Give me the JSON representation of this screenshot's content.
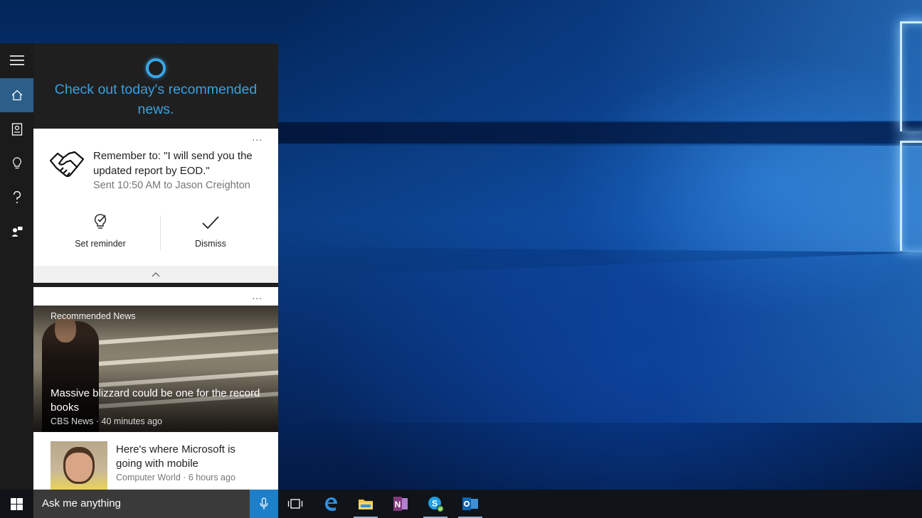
{
  "cortana": {
    "greeting": "Check out today's recommended news.",
    "rail": [
      {
        "name": "menu",
        "icon": "hamburger-menu-icon"
      },
      {
        "name": "home",
        "icon": "home-icon",
        "active": true
      },
      {
        "name": "notebook",
        "icon": "notebook-icon"
      },
      {
        "name": "reminders",
        "icon": "lightbulb-icon"
      },
      {
        "name": "help",
        "icon": "question-mark-icon"
      },
      {
        "name": "feedback",
        "icon": "feedback-icon"
      }
    ],
    "reminder_card": {
      "more": "...",
      "icon": "handshake-icon",
      "text": "Remember to: \"I will send you the updated report by EOD.\"",
      "subtext": "Sent 10:50 AM to Jason Creighton",
      "actions": [
        {
          "label": "Set reminder",
          "icon": "lightbulb-check-icon"
        },
        {
          "label": "Dismiss",
          "icon": "checkmark-icon"
        }
      ]
    },
    "news_card": {
      "more": "...",
      "section_label": "Recommended News",
      "hero": {
        "title": "Massive blizzard could be one for the record books",
        "meta": "CBS News · 40 minutes ago"
      },
      "item": {
        "title": "Here's where Microsoft is going with mobile",
        "meta": "Computer World · 6 hours ago"
      }
    }
  },
  "taskbar": {
    "search_placeholder": "Ask me anything",
    "apps": [
      {
        "name": "task-view",
        "icon": "task-view-icon"
      },
      {
        "name": "edge",
        "icon": "edge-icon"
      },
      {
        "name": "file-explorer",
        "icon": "folder-icon"
      },
      {
        "name": "onenote",
        "icon": "onenote-icon"
      },
      {
        "name": "skype",
        "icon": "skype-icon"
      },
      {
        "name": "outlook",
        "icon": "outlook-icon"
      }
    ]
  },
  "colors": {
    "accent": "#3aa0e0",
    "mic_button": "#1d7fc9",
    "active_rail": "#2b5f8a"
  }
}
